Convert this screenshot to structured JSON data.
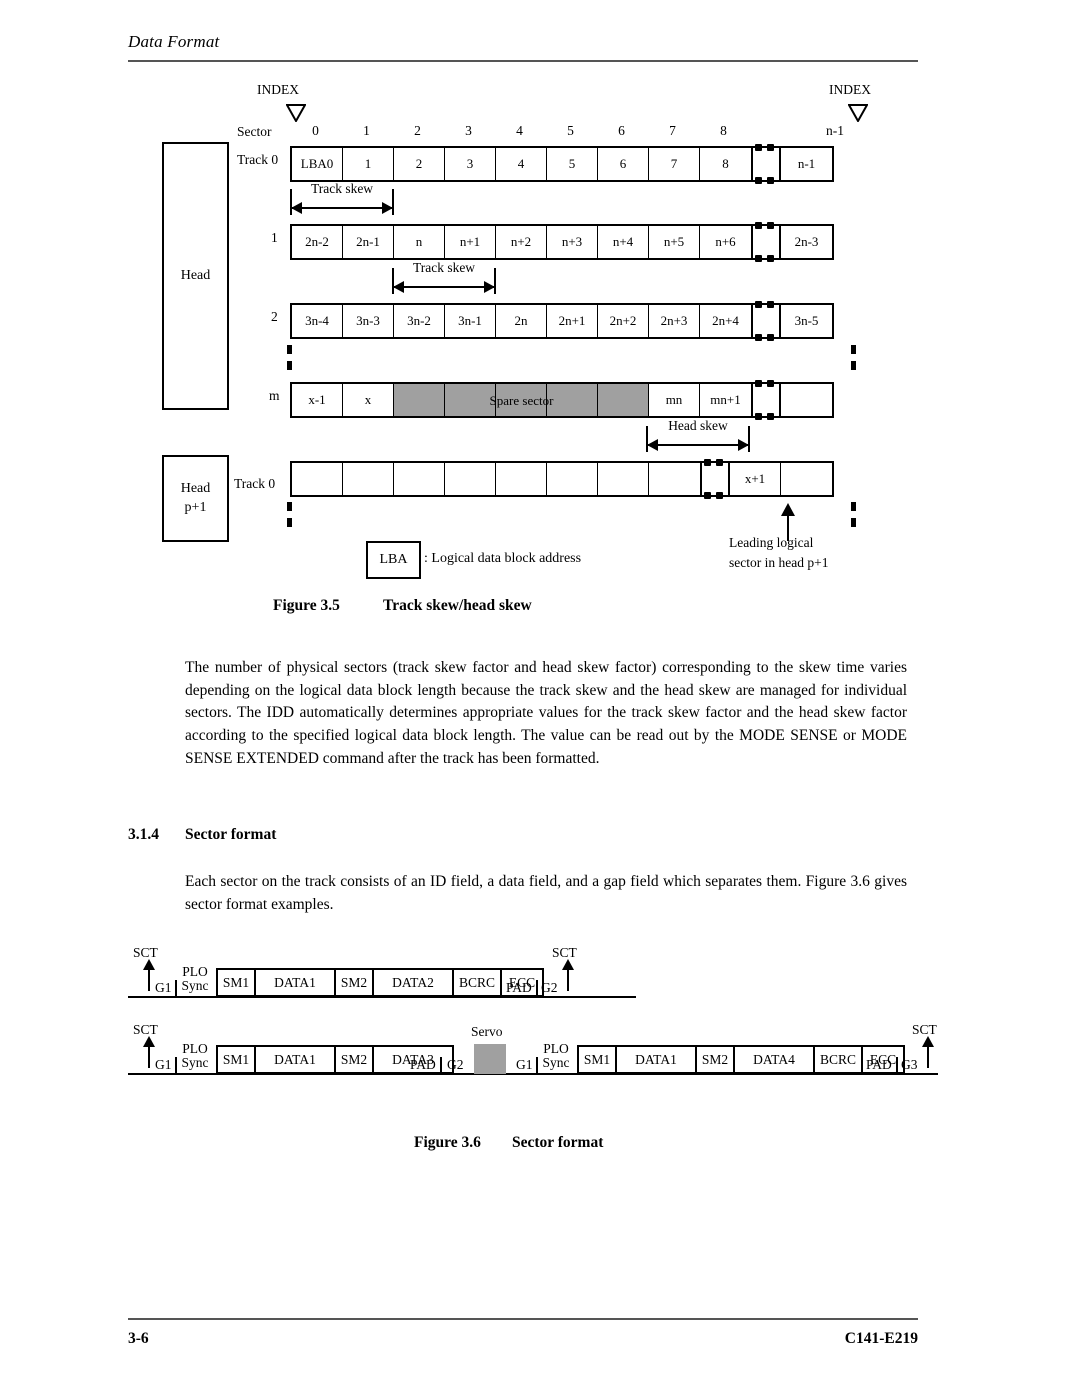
{
  "page": {
    "running_head": "Data Format",
    "folio": "3-6",
    "doc_id": "C141-E219"
  },
  "figure_35": {
    "caption_number": "Figure 3.5",
    "caption_title": "Track skew/head skew",
    "index_label_left": "INDEX",
    "index_label_right": "INDEX",
    "sector_label": "Sector",
    "sector_numbers": [
      "0",
      "1",
      "2",
      "3",
      "4",
      "5",
      "6",
      "7",
      "8"
    ],
    "sector_number_last": "n-1",
    "head_group_label": "Head",
    "head_group_label_2_line1": "Head",
    "head_group_label_2_line2": "p+1",
    "row_labels": {
      "track0": "Track 0",
      "r1": "1",
      "r2": "2",
      "rm": "m",
      "bottom_track0": "Track 0"
    },
    "rows": [
      {
        "name": "track0",
        "cells": [
          "LBA0",
          "1",
          "2",
          "3",
          "4",
          "5",
          "6",
          "7",
          "8"
        ],
        "tail_cells": [
          "n-1"
        ]
      },
      {
        "name": "head1",
        "cells": [
          "2n-2",
          "2n-1",
          "n",
          "n+1",
          "n+2",
          "n+3",
          "n+4",
          "n+5",
          "n+6"
        ],
        "tail_cells": [
          "2n-3"
        ]
      },
      {
        "name": "head2",
        "cells": [
          "3n-4",
          "3n-3",
          "3n-2",
          "3n-1",
          "2n",
          "2n+1",
          "2n+2",
          "2n+3",
          "2n+4"
        ],
        "tail_cells": [
          "3n-5"
        ]
      },
      {
        "name": "headm",
        "cells": [
          "x-1",
          "x",
          "",
          "",
          "",
          "",
          "",
          "mn",
          "mn+1"
        ],
        "tail_cells": [
          ""
        ],
        "shaded_indices": [
          2,
          3,
          4,
          5,
          6
        ],
        "overlay_text": "Spare sector"
      },
      {
        "name": "head_p1_track0",
        "cells": [
          "",
          "",
          "",
          "",
          "",
          "",
          "",
          ""
        ],
        "tail_cells": [
          "x+1",
          ""
        ]
      }
    ],
    "track_skew_label_1": "Track skew",
    "track_skew_label_2": "Track skew",
    "head_skew_label": "Head skew",
    "legend_box": "LBA",
    "legend_text": ": Logical data block address",
    "leading_note_line1": "Leading logical",
    "leading_note_line2": "sector in head p+1"
  },
  "body": {
    "paragraph_1": "The number of physical sectors (track skew factor and head skew factor) corresponding to the skew time varies depending on the logical data block length because the track skew and the head skew are managed for individual sectors.  The IDD automatically determines appropriate values for the track skew factor and the head skew factor according to the specified logical data block length.  The value can be read out by the MODE SENSE or MODE SENSE EXTENDED command after the track has been formatted.",
    "section_number": "3.1.4",
    "section_title": "Sector format",
    "paragraph_2": "Each sector on the track consists of an ID field, a data field, and a gap field which separates them.  Figure 3.6 gives sector format examples."
  },
  "figure_36": {
    "caption_number": "Figure 3.6",
    "caption_title": "Sector format",
    "sct_label": "SCT",
    "servo_label": "Servo",
    "row_1": {
      "gap_start": "G1",
      "plo_sync_line1": "PLO",
      "plo_sync_line2": "Sync",
      "fields": [
        "SM1",
        "DATA1",
        "SM2",
        "DATA2",
        "BCRC",
        "ECC"
      ],
      "pad": "PAD",
      "gap_end": "G2"
    },
    "row_2": {
      "gap_start": "G1",
      "plo_sync_line1": "PLO",
      "plo_sync_line2": "Sync",
      "fields_a": [
        "SM1",
        "DATA1",
        "SM2",
        "DATA3"
      ],
      "pad_a": "PAD",
      "gap_mid": "G2",
      "servo": "Servo",
      "gap_start_2": "G1",
      "plo_sync2_line1": "PLO",
      "plo_sync2_line2": "Sync",
      "fields_b": [
        "SM1",
        "DATA1",
        "SM2",
        "DATA4",
        "BCRC",
        "ECC"
      ],
      "pad_b": "PAD",
      "gap_end": "G3"
    }
  },
  "colors": {
    "rule": "#555555",
    "shade": "#a0a0a0",
    "ink": "#000000"
  }
}
